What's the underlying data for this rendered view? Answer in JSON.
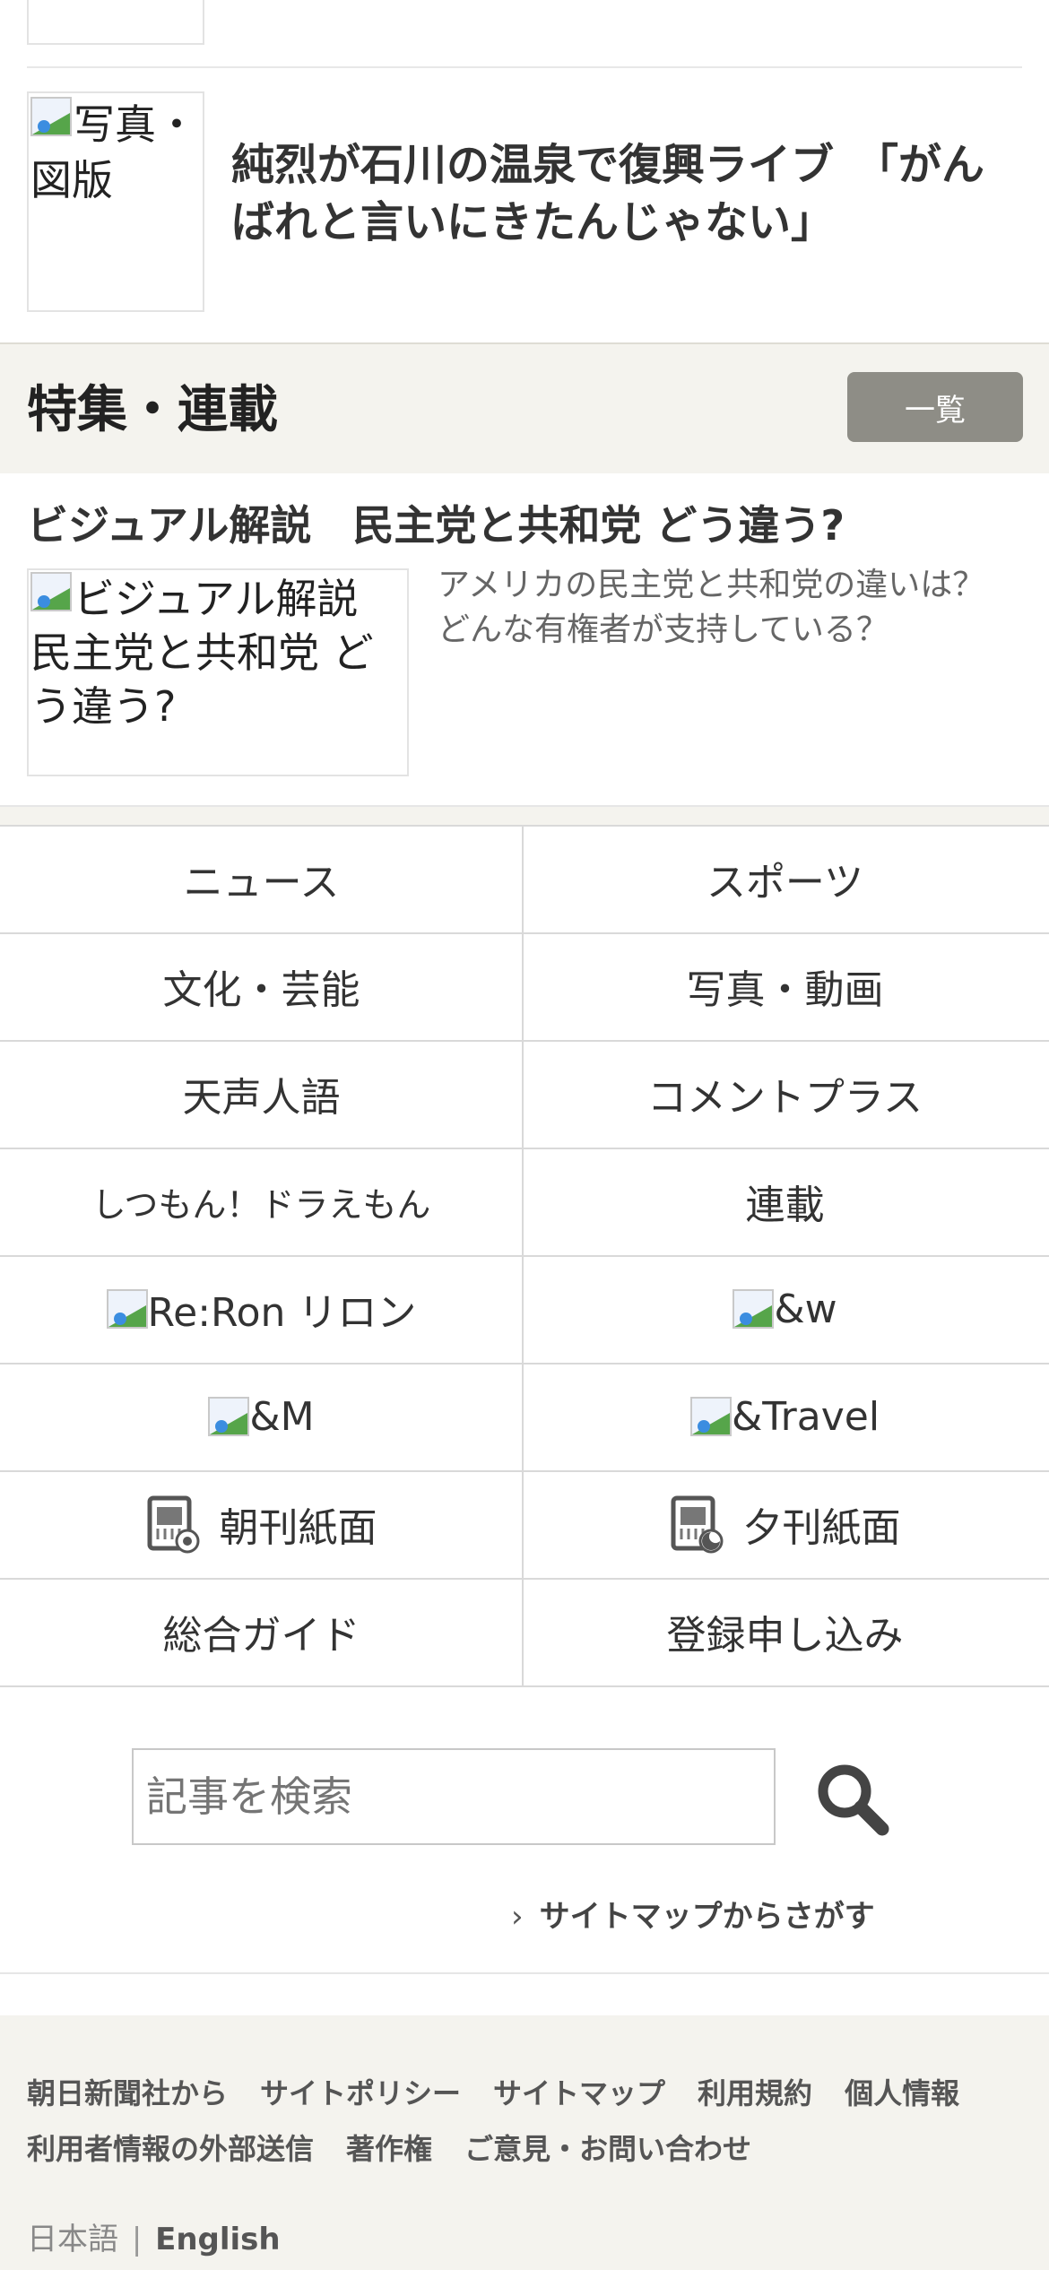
{
  "articles": [
    {
      "image_alt": "写真・図版",
      "title": "純烈が石川の温泉で復興ライブ　「がんばれと言いにきたんじゃない」"
    }
  ],
  "feature_section": {
    "heading": "特集・連載",
    "list_button": "一覧",
    "item": {
      "title": "ビジュアル解説　民主党と共和党 どう違う?",
      "image_alt": "ビジュアル解説　民主党と共和党 どう違う?",
      "description": "アメリカの民主党と共和党の違いは？どんな有権者が支持している？"
    }
  },
  "nav_grid": [
    {
      "label": "ニュース",
      "icon": null
    },
    {
      "label": "スポーツ",
      "icon": null
    },
    {
      "label": "文化・芸能",
      "icon": null
    },
    {
      "label": "写真・動画",
      "icon": null
    },
    {
      "label": "天声人語",
      "icon": null
    },
    {
      "label": "コメントプラス",
      "icon": null
    },
    {
      "label": "しつもん！ドラえもん",
      "icon": null
    },
    {
      "label": "連載",
      "icon": null
    },
    {
      "label": "Re:Ron リロン",
      "icon": "broken-image-icon"
    },
    {
      "label": "&w",
      "icon": "broken-image-icon"
    },
    {
      "label": "&M",
      "icon": "broken-image-icon"
    },
    {
      "label": "&Travel",
      "icon": "broken-image-icon"
    },
    {
      "label": "朝刊紙面",
      "icon": "newspaper-morning-icon"
    },
    {
      "label": "夕刊紙面",
      "icon": "newspaper-evening-icon"
    },
    {
      "label": "総合ガイド",
      "icon": null
    },
    {
      "label": "登録申し込み",
      "icon": null
    }
  ],
  "search": {
    "placeholder": "記事を検索",
    "sitemap_link": "サイトマップからさがす"
  },
  "footer": {
    "links_row1": [
      "朝日新聞社から",
      "サイトポリシー",
      "サイトマップ",
      "利用規約",
      "個人情報"
    ],
    "links_row2": [
      "利用者情報の外部送信",
      "著作権",
      "ご意見・お問い合わせ"
    ],
    "lang_ja": "日本語",
    "lang_separator": "|",
    "lang_en": "English"
  },
  "colors": {
    "section_bg": "#f4f3ee",
    "button_bg": "#8e8d86",
    "divider": "#e6e6e6"
  }
}
